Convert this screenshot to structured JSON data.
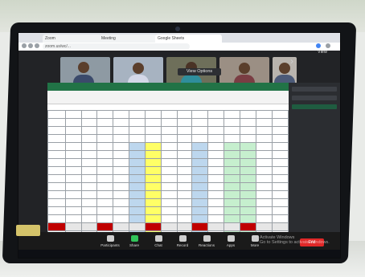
{
  "browser": {
    "tabs": [
      "Zoom",
      "Meeting",
      "Google Sheets"
    ],
    "url": "zoom.us/wc/..."
  },
  "zoom": {
    "view_options_label": "View Options",
    "view_label": "View",
    "participants": [
      {
        "name": ""
      },
      {
        "name": ""
      },
      {
        "name": ""
      },
      {
        "name": ""
      },
      {
        "name": ""
      }
    ],
    "toolbar": {
      "items": [
        "Participants",
        "Share",
        "Chat",
        "Record",
        "Reactions",
        "Apps",
        "More"
      ],
      "end_label": "End"
    }
  },
  "windows": {
    "activate_line1": "Activate Windows",
    "activate_line2": "Go to Settings to activate Windows."
  },
  "colors": {
    "excel_green": "#217346",
    "zoom_end_red": "#e02828",
    "highlight_yellow": "#ffff66",
    "highlight_blue": "#bdd7ee",
    "highlight_green": "#c6efce"
  }
}
